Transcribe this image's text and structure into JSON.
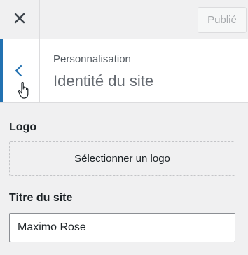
{
  "header": {
    "close_icon": "close-icon",
    "publish_label": "Publié"
  },
  "section": {
    "back_icon": "chevron-left-icon",
    "breadcrumb": "Personnalisation",
    "title": "Identité du site"
  },
  "logo": {
    "label": "Logo",
    "select_button": "Sélectionner un logo"
  },
  "site_title": {
    "label": "Titre du site",
    "value": "Maximo Rose"
  },
  "colors": {
    "accent": "#2271b1",
    "background": "#f0f0f1",
    "border": "#dcdcde"
  }
}
